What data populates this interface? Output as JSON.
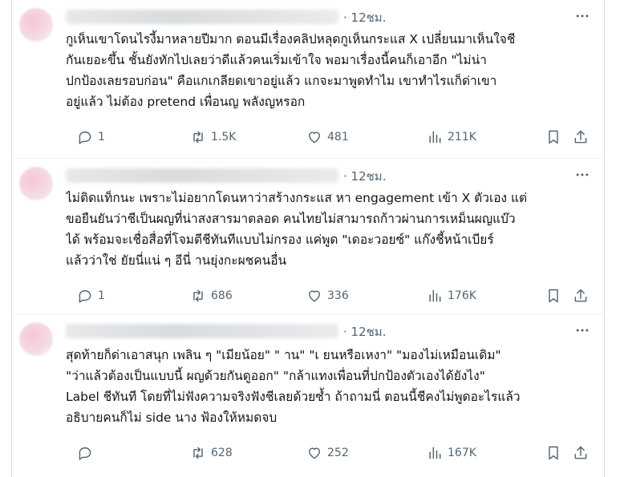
{
  "replies": [
    {
      "time": "· 12ชม.",
      "lines": [
        "กูเห็นเขาโดนไรงี้มาหลายปีมาก ตอนมีเรื่องคลิปหลุดกูเห็นกระแส X เปลี่ยนมาเห็นใจชี",
        "กันเยอะขึ้น ชั้นยังทักไปเลยว่าดีแล้วคนเริ่มเข้าใจ พอมาเรื่องนี้คนก็เอาอีก \"ไม่น่า",
        "ปกป้องเลยรอบก่อน\" คือแกเกลียดเขาอยู่แล้ว แกจะมาพูดทำไม เขาทำไรแก็ด่าเขา",
        "อยู่แล้ว ไม่ต้อง pretend เพื่อนญ พลังญหรอก"
      ],
      "replies_count": "1",
      "reposts": "1.5K",
      "likes": "481",
      "views": "211K"
    },
    {
      "time": "· 12ชม.",
      "lines": [
        "ไม่ติดแท็กนะ เพราะไม่อยากโดนหาว่าสร้างกระแส หา engagement เข้า X ตัวเอง แต่",
        "ขอยืนยันว่าชีเป็นผญที่น่าสงสารมาตลอด คนไทยไม่สามารถก้าวผ่านการเหม็นผญแบ๊ว",
        "ได้ พร้อมจะเชื่อสื่อที่โจมตีชีทันทีแบบไม่กรอง แค่พูด \"เดอะวอยซ์\" แก๊งชี้หน้าเบียร์",
        "แล้วว่าใช่ ยัยนี่แน่ ๆ อีนี่ านยุ่งกะผชคนอื่น"
      ],
      "replies_count": "1",
      "reposts": "686",
      "likes": "336",
      "views": "176K"
    },
    {
      "time": "· 12ชม.",
      "lines": [
        "สุดท้ายก็ด่าเอาสนุก เพลิน ๆ \"เมียน้อย\" \" าน\" \"เ ยนหรือเหงา\" \"มองไม่เหมือนเดิม\"",
        "\"ว่าแล้วต้องเป็นแบบนี้ ผญด้วยกันดูออก\" \"กล้าแทงเพื่อนที่ปกป้องตัวเองได้ยังไง\"",
        "Label ชีทันที โดยที่ไม่ฟังความจริงฟังชีเลยด้วยซ้ำ ถ้าถามนี่ ตอนนี้ชีคงไม่พูดอะไรแล้ว",
        "อธิบายคนก็ไม่ side นาง ฟ้องให้หมดจบ"
      ],
      "replies_count": "",
      "reposts": "628",
      "likes": "252",
      "views": "167K"
    }
  ],
  "icons": {
    "more": "more-horizontal-icon",
    "reply": "reply-bubble-icon",
    "repost": "repost-icon",
    "like": "heart-icon",
    "views": "analytics-bars-icon",
    "bookmark": "bookmark-icon",
    "share": "share-upload-icon"
  },
  "colors": {
    "text": "#0f1419",
    "muted": "#536471",
    "divider": "#eff3f4"
  }
}
